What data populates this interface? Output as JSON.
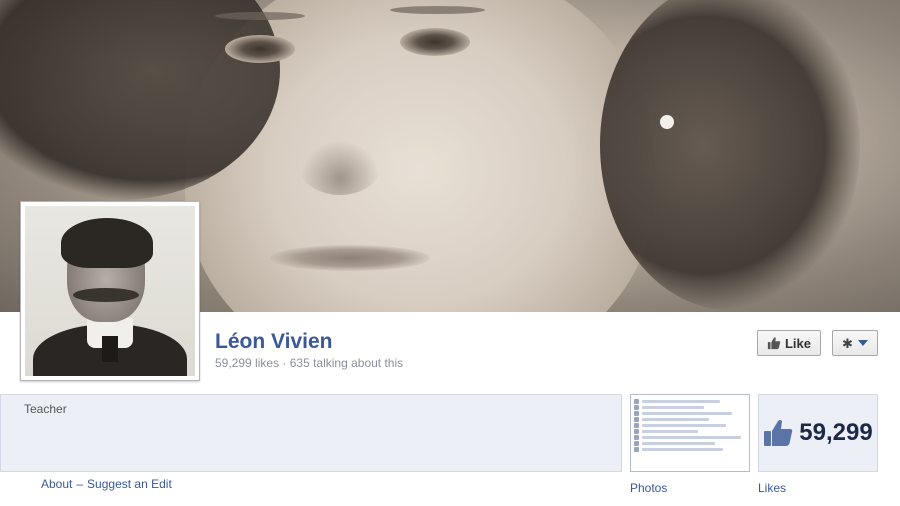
{
  "page": {
    "name": "Léon Vivien",
    "likes_count": "59,299 likes",
    "talking_about": "635 talking about this",
    "stats_separator": " · "
  },
  "actions": {
    "like_label": "Like",
    "settings_icon": "gear-icon"
  },
  "about": {
    "category": "Teacher",
    "about_link": "About",
    "separator": "–",
    "suggest_edit_link": "Suggest an Edit"
  },
  "apps": {
    "photos_label": "Photos",
    "likes_label": "Likes",
    "likes_number": "59,299"
  },
  "colors": {
    "link": "#3b5998",
    "app_bg": "#eceff5"
  }
}
